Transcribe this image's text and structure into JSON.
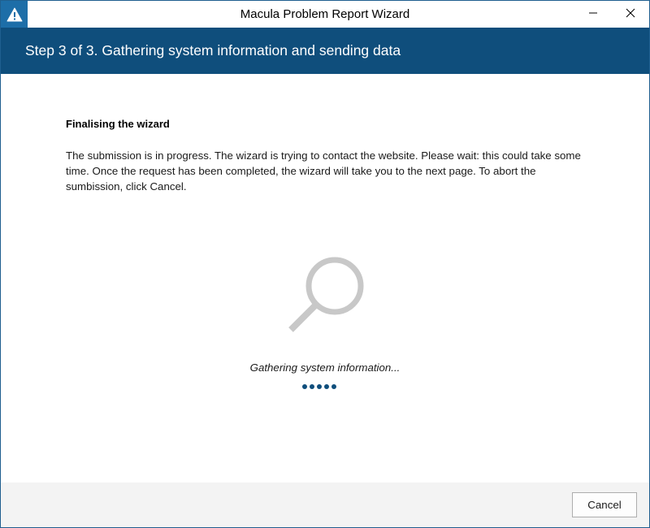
{
  "window": {
    "title": "Macula Problem Report Wizard",
    "app_icon": "warning-icon",
    "minimize_icon": "minimize-icon",
    "close_icon": "close-icon"
  },
  "banner": {
    "title": "Step 3 of 3. Gathering system information and sending data",
    "color": "#0f4e7c"
  },
  "content": {
    "heading": "Finalising the wizard",
    "body": "The submission is in progress. The wizard is trying to contact the website. Please wait: this could take some time. Once the request has been completed, the wizard will take you to the next page. To abort the sumbission, click Cancel.",
    "illustration_icon": "magnifier-icon",
    "status": "Gathering system information...",
    "progress_indicator": "loading-dots",
    "progress_dot_count": 5
  },
  "footer": {
    "cancel_label": "Cancel"
  },
  "colors": {
    "accent": "#0f4e7c",
    "titlebar_icon_bg": "#1d6ea8",
    "footer_bg": "#f3f3f3",
    "magnifier": "#c8c8c8"
  }
}
